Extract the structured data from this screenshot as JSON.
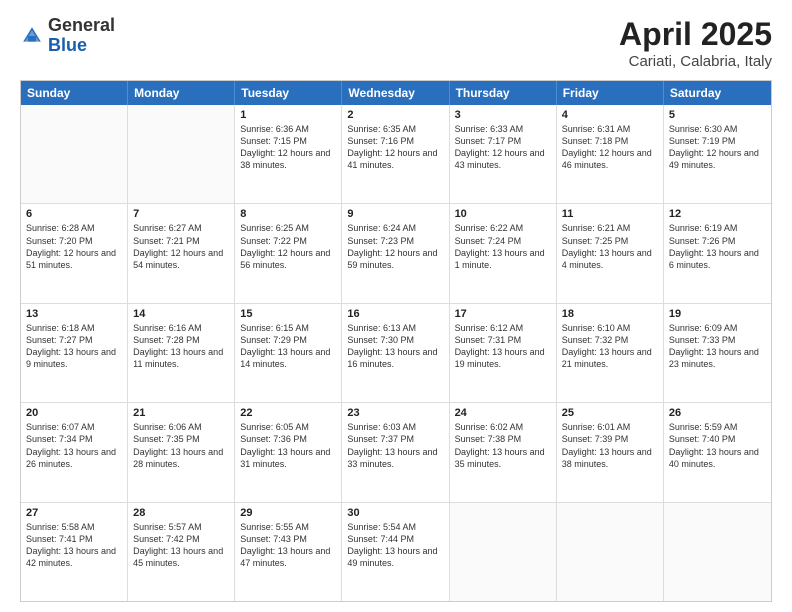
{
  "header": {
    "logo": {
      "general": "General",
      "blue": "Blue"
    },
    "title": "April 2025",
    "location": "Cariati, Calabria, Italy"
  },
  "days_of_week": [
    "Sunday",
    "Monday",
    "Tuesday",
    "Wednesday",
    "Thursday",
    "Friday",
    "Saturday"
  ],
  "weeks": [
    [
      {
        "day": "",
        "empty": true
      },
      {
        "day": "",
        "empty": true
      },
      {
        "day": "1",
        "sunrise": "Sunrise: 6:36 AM",
        "sunset": "Sunset: 7:15 PM",
        "daylight": "Daylight: 12 hours and 38 minutes."
      },
      {
        "day": "2",
        "sunrise": "Sunrise: 6:35 AM",
        "sunset": "Sunset: 7:16 PM",
        "daylight": "Daylight: 12 hours and 41 minutes."
      },
      {
        "day": "3",
        "sunrise": "Sunrise: 6:33 AM",
        "sunset": "Sunset: 7:17 PM",
        "daylight": "Daylight: 12 hours and 43 minutes."
      },
      {
        "day": "4",
        "sunrise": "Sunrise: 6:31 AM",
        "sunset": "Sunset: 7:18 PM",
        "daylight": "Daylight: 12 hours and 46 minutes."
      },
      {
        "day": "5",
        "sunrise": "Sunrise: 6:30 AM",
        "sunset": "Sunset: 7:19 PM",
        "daylight": "Daylight: 12 hours and 49 minutes."
      }
    ],
    [
      {
        "day": "6",
        "sunrise": "Sunrise: 6:28 AM",
        "sunset": "Sunset: 7:20 PM",
        "daylight": "Daylight: 12 hours and 51 minutes."
      },
      {
        "day": "7",
        "sunrise": "Sunrise: 6:27 AM",
        "sunset": "Sunset: 7:21 PM",
        "daylight": "Daylight: 12 hours and 54 minutes."
      },
      {
        "day": "8",
        "sunrise": "Sunrise: 6:25 AM",
        "sunset": "Sunset: 7:22 PM",
        "daylight": "Daylight: 12 hours and 56 minutes."
      },
      {
        "day": "9",
        "sunrise": "Sunrise: 6:24 AM",
        "sunset": "Sunset: 7:23 PM",
        "daylight": "Daylight: 12 hours and 59 minutes."
      },
      {
        "day": "10",
        "sunrise": "Sunrise: 6:22 AM",
        "sunset": "Sunset: 7:24 PM",
        "daylight": "Daylight: 13 hours and 1 minute."
      },
      {
        "day": "11",
        "sunrise": "Sunrise: 6:21 AM",
        "sunset": "Sunset: 7:25 PM",
        "daylight": "Daylight: 13 hours and 4 minutes."
      },
      {
        "day": "12",
        "sunrise": "Sunrise: 6:19 AM",
        "sunset": "Sunset: 7:26 PM",
        "daylight": "Daylight: 13 hours and 6 minutes."
      }
    ],
    [
      {
        "day": "13",
        "sunrise": "Sunrise: 6:18 AM",
        "sunset": "Sunset: 7:27 PM",
        "daylight": "Daylight: 13 hours and 9 minutes."
      },
      {
        "day": "14",
        "sunrise": "Sunrise: 6:16 AM",
        "sunset": "Sunset: 7:28 PM",
        "daylight": "Daylight: 13 hours and 11 minutes."
      },
      {
        "day": "15",
        "sunrise": "Sunrise: 6:15 AM",
        "sunset": "Sunset: 7:29 PM",
        "daylight": "Daylight: 13 hours and 14 minutes."
      },
      {
        "day": "16",
        "sunrise": "Sunrise: 6:13 AM",
        "sunset": "Sunset: 7:30 PM",
        "daylight": "Daylight: 13 hours and 16 minutes."
      },
      {
        "day": "17",
        "sunrise": "Sunrise: 6:12 AM",
        "sunset": "Sunset: 7:31 PM",
        "daylight": "Daylight: 13 hours and 19 minutes."
      },
      {
        "day": "18",
        "sunrise": "Sunrise: 6:10 AM",
        "sunset": "Sunset: 7:32 PM",
        "daylight": "Daylight: 13 hours and 21 minutes."
      },
      {
        "day": "19",
        "sunrise": "Sunrise: 6:09 AM",
        "sunset": "Sunset: 7:33 PM",
        "daylight": "Daylight: 13 hours and 23 minutes."
      }
    ],
    [
      {
        "day": "20",
        "sunrise": "Sunrise: 6:07 AM",
        "sunset": "Sunset: 7:34 PM",
        "daylight": "Daylight: 13 hours and 26 minutes."
      },
      {
        "day": "21",
        "sunrise": "Sunrise: 6:06 AM",
        "sunset": "Sunset: 7:35 PM",
        "daylight": "Daylight: 13 hours and 28 minutes."
      },
      {
        "day": "22",
        "sunrise": "Sunrise: 6:05 AM",
        "sunset": "Sunset: 7:36 PM",
        "daylight": "Daylight: 13 hours and 31 minutes."
      },
      {
        "day": "23",
        "sunrise": "Sunrise: 6:03 AM",
        "sunset": "Sunset: 7:37 PM",
        "daylight": "Daylight: 13 hours and 33 minutes."
      },
      {
        "day": "24",
        "sunrise": "Sunrise: 6:02 AM",
        "sunset": "Sunset: 7:38 PM",
        "daylight": "Daylight: 13 hours and 35 minutes."
      },
      {
        "day": "25",
        "sunrise": "Sunrise: 6:01 AM",
        "sunset": "Sunset: 7:39 PM",
        "daylight": "Daylight: 13 hours and 38 minutes."
      },
      {
        "day": "26",
        "sunrise": "Sunrise: 5:59 AM",
        "sunset": "Sunset: 7:40 PM",
        "daylight": "Daylight: 13 hours and 40 minutes."
      }
    ],
    [
      {
        "day": "27",
        "sunrise": "Sunrise: 5:58 AM",
        "sunset": "Sunset: 7:41 PM",
        "daylight": "Daylight: 13 hours and 42 minutes."
      },
      {
        "day": "28",
        "sunrise": "Sunrise: 5:57 AM",
        "sunset": "Sunset: 7:42 PM",
        "daylight": "Daylight: 13 hours and 45 minutes."
      },
      {
        "day": "29",
        "sunrise": "Sunrise: 5:55 AM",
        "sunset": "Sunset: 7:43 PM",
        "daylight": "Daylight: 13 hours and 47 minutes."
      },
      {
        "day": "30",
        "sunrise": "Sunrise: 5:54 AM",
        "sunset": "Sunset: 7:44 PM",
        "daylight": "Daylight: 13 hours and 49 minutes."
      },
      {
        "day": "",
        "empty": true
      },
      {
        "day": "",
        "empty": true
      },
      {
        "day": "",
        "empty": true
      }
    ]
  ]
}
